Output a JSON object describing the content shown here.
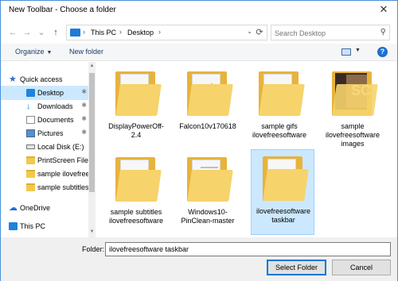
{
  "window": {
    "title": "New Toolbar - Choose a folder",
    "close_glyph": "✕"
  },
  "nav": {
    "back": "←",
    "forward": "→",
    "recent": "⌄",
    "up": "↑"
  },
  "address": {
    "crumbs": [
      "This PC",
      "Desktop"
    ],
    "separator": "›",
    "dropdown": "⌄",
    "refresh": "⟳"
  },
  "search": {
    "placeholder": "Search Desktop",
    "icon": "⚲"
  },
  "commands": {
    "organize": "Organize",
    "organize_caret": "▼",
    "new_folder": "New folder",
    "view_caret": "▼",
    "help": "?"
  },
  "sidebar": {
    "items": [
      {
        "label": "Quick access",
        "icon": "star-icon",
        "pinned": false
      },
      {
        "label": "Desktop",
        "icon": "desktop-icon",
        "pinned": true,
        "selected": true
      },
      {
        "label": "Downloads",
        "icon": "download-icon",
        "pinned": true
      },
      {
        "label": "Documents",
        "icon": "document-icon",
        "pinned": true
      },
      {
        "label": "Pictures",
        "icon": "pictures-icon",
        "pinned": true
      },
      {
        "label": "Local Disk (E:)",
        "icon": "disk-icon",
        "pinned": false
      },
      {
        "label": "PrintScreen Files",
        "icon": "folder-icon",
        "pinned": false
      },
      {
        "label": "sample ilovefree",
        "icon": "folder-icon",
        "pinned": false
      },
      {
        "label": "sample subtitles",
        "icon": "folder-icon",
        "pinned": false
      },
      {
        "label": "OneDrive",
        "icon": "cloud-icon",
        "pinned": false
      },
      {
        "label": "This PC",
        "icon": "pc-icon",
        "pinned": false
      }
    ],
    "pin_glyph": "📌",
    "scroll_up": "▲",
    "scroll_down": "▼"
  },
  "files": [
    {
      "label": "DisplayPowerOff-2.4",
      "thumb": "paper"
    },
    {
      "label": "Falcon10v170618",
      "thumb": "gear"
    },
    {
      "label": "sample gifs ilovefreesoftware",
      "thumb": "plain"
    },
    {
      "label": "sample ilovefreesoftware images",
      "thumb": "dark",
      "thumb_text": "SC"
    },
    {
      "label": "sample subtitles ilovefreesoftware",
      "thumb": "paper"
    },
    {
      "label": "Windows10-PinClean-master",
      "thumb": "lines"
    },
    {
      "label": "ilovefreesoftware taskbar",
      "thumb": "plain",
      "selected": true
    }
  ],
  "footer": {
    "folder_label": "Folder:",
    "folder_value": "ilovefreesoftware taskbar",
    "select_button": "Select Folder",
    "cancel_button": "Cancel"
  }
}
